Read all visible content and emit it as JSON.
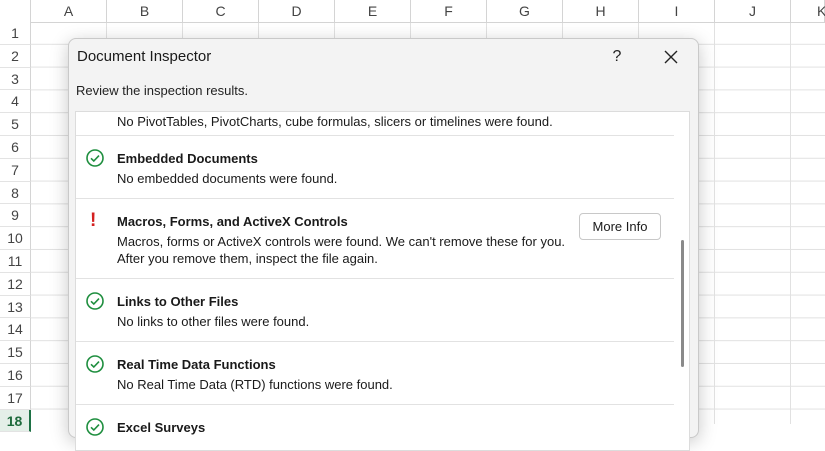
{
  "sheet": {
    "columns": [
      "A",
      "B",
      "C",
      "D",
      "E",
      "F",
      "G",
      "H",
      "I",
      "J",
      "K"
    ],
    "rows": [
      "1",
      "2",
      "3",
      "4",
      "5",
      "6",
      "7",
      "8",
      "9",
      "10",
      "11",
      "12",
      "13",
      "14",
      "15",
      "16",
      "17",
      "18"
    ],
    "active_row": "18"
  },
  "dialog": {
    "title": "Document Inspector",
    "help_label": "?",
    "close_label": "✕",
    "subtitle": "Review the inspection results.",
    "sections": [
      {
        "status": "ok",
        "title": "",
        "lines": [
          "No PivotTables, PivotCharts, cube formulas, slicers or timelines were found."
        ]
      },
      {
        "status": "ok",
        "icon": "check-circle-icon",
        "title": "Embedded Documents",
        "lines": [
          "No embedded documents were found."
        ]
      },
      {
        "status": "warning",
        "icon": "warning-icon",
        "mark": "!",
        "title": "Macros, Forms, and ActiveX Controls",
        "lines": [
          "Macros, forms or ActiveX controls were found. We can't remove these for you.",
          "After you remove them, inspect the file again."
        ],
        "button_label": "More Info"
      },
      {
        "status": "ok",
        "icon": "check-circle-icon",
        "title": "Links to Other Files",
        "lines": [
          "No links to other files were found."
        ]
      },
      {
        "status": "ok",
        "icon": "check-circle-icon",
        "title": "Real Time Data Functions",
        "lines": [
          "No Real Time Data (RTD) functions were found."
        ]
      },
      {
        "status": "ok",
        "icon": "check-circle-icon",
        "title": "Excel Surveys",
        "lines": []
      }
    ]
  },
  "colors": {
    "ok": "#1e8e3e",
    "warning": "#d42020",
    "accent": "#1e7145"
  }
}
